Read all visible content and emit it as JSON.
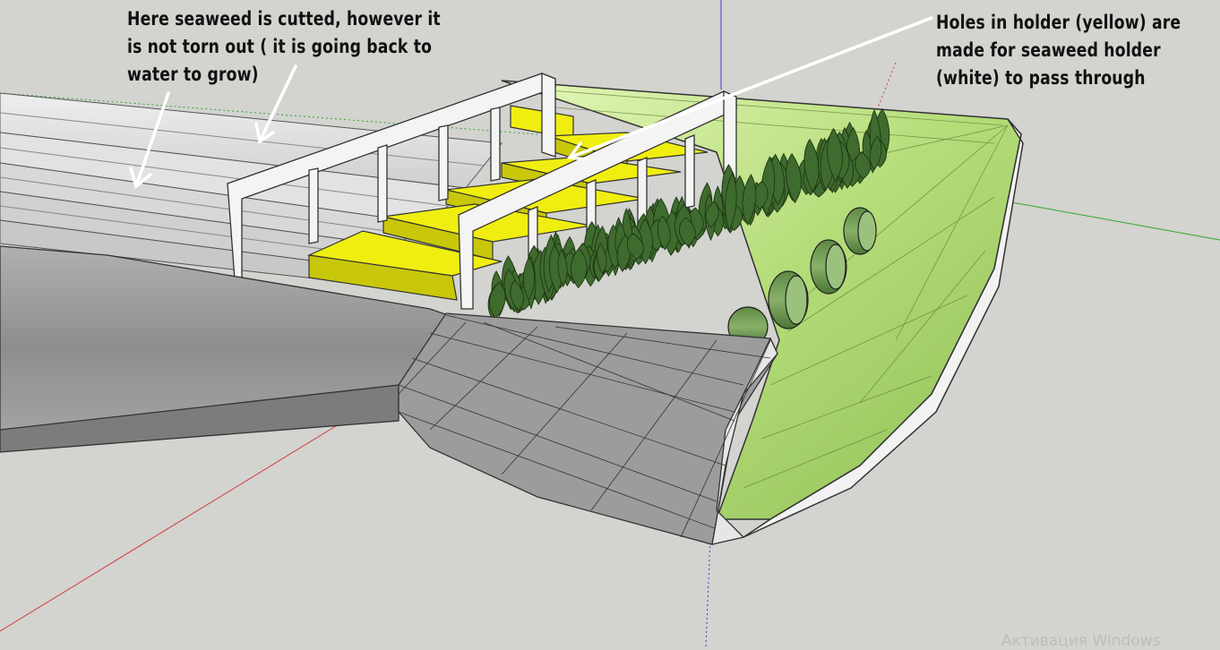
{
  "annotations": {
    "left": {
      "lines": [
        "Here seaweed is cutted, however it",
        "is not torn out ( it is going back to",
        "water to grow)"
      ]
    },
    "right": {
      "lines": [
        "Holes in holder (yellow) are",
        "made for seaweed holder",
        "(white) to pass through"
      ]
    }
  },
  "watermark": "Активация Windows",
  "colors": {
    "background": "#d3d3cf",
    "holder_yellow": "#f0ee10",
    "frame_white": "#f4f4f4",
    "hull_gray": "#9a9a9a",
    "scoop_green": "#b8e07a",
    "seaweed": "#3f6b2e",
    "axis_red": "#d23c3c",
    "axis_green": "#2ea82e",
    "axis_blue": "#3c3cd2"
  }
}
